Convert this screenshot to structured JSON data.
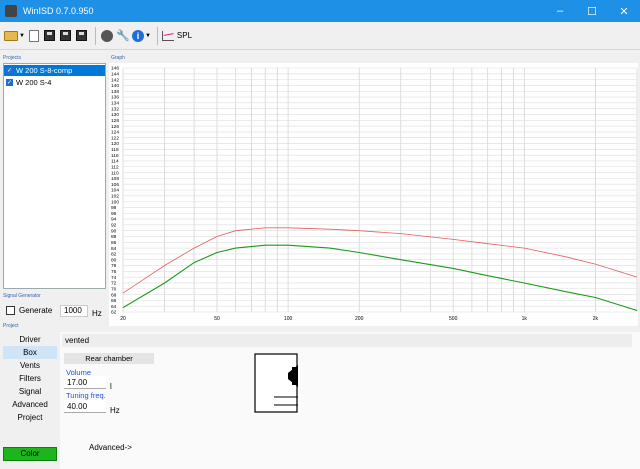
{
  "window": {
    "title": "WinISD 0.7.0.950",
    "controls": [
      "–",
      "☐",
      "✕"
    ]
  },
  "toolbar": {
    "spl_label": "SPL"
  },
  "sections": {
    "projects": "Projects",
    "graph": "Graph",
    "signal_generator": "Signal Generator",
    "project": "Project"
  },
  "projects": [
    {
      "name": "W 200 S-8-comp",
      "checked": true,
      "selected": true
    },
    {
      "name": "W 200 S-4",
      "checked": true,
      "selected": false
    }
  ],
  "signal_generator": {
    "generate_label": "Generate",
    "frequency": "1000",
    "unit": "Hz"
  },
  "nav": [
    "Driver",
    "Box",
    "Vents",
    "Filters",
    "Signal",
    "Advanced",
    "Project"
  ],
  "nav_active": "Box",
  "color_button": "Color",
  "box": {
    "type": "vented",
    "chamber_label": "Rear chamber",
    "volume_label": "Volume",
    "volume_value": "17.00",
    "volume_unit": "l",
    "tuning_label": "Tuning freq.",
    "tuning_value": "40.00",
    "tuning_unit": "Hz",
    "advanced_label": "Advanced->"
  },
  "chart_data": {
    "type": "line",
    "xscale": "log",
    "xlim": [
      20,
      3000
    ],
    "ylim": [
      62,
      146
    ],
    "ytick_step": 2,
    "xticks": [
      {
        "value": 20,
        "label": "20"
      },
      {
        "value": 50,
        "label": "50"
      },
      {
        "value": 100,
        "label": "100"
      },
      {
        "value": 200,
        "label": "200"
      },
      {
        "value": 500,
        "label": "500"
      },
      {
        "value": 1000,
        "label": "1k"
      },
      {
        "value": 2000,
        "label": "2k"
      }
    ],
    "grid": true,
    "series": [
      {
        "color": "#e06060",
        "x": [
          20,
          30,
          40,
          50,
          60,
          80,
          100,
          150,
          200,
          300,
          500,
          700,
          1000,
          1500,
          2000,
          3000
        ],
        "y": [
          68.5,
          78,
          84,
          88,
          90,
          91,
          91,
          90.5,
          90,
          89,
          87,
          85.5,
          84,
          81,
          78.5,
          74
        ]
      },
      {
        "color": "#1a9a1a",
        "x": [
          20,
          30,
          40,
          50,
          60,
          80,
          100,
          150,
          200,
          300,
          500,
          700,
          1000,
          1500,
          2000,
          3000
        ],
        "y": [
          63.5,
          72,
          79,
          82.5,
          84,
          85,
          85,
          84,
          82.5,
          80,
          77,
          74.5,
          72,
          69,
          67,
          62.5
        ]
      }
    ]
  }
}
